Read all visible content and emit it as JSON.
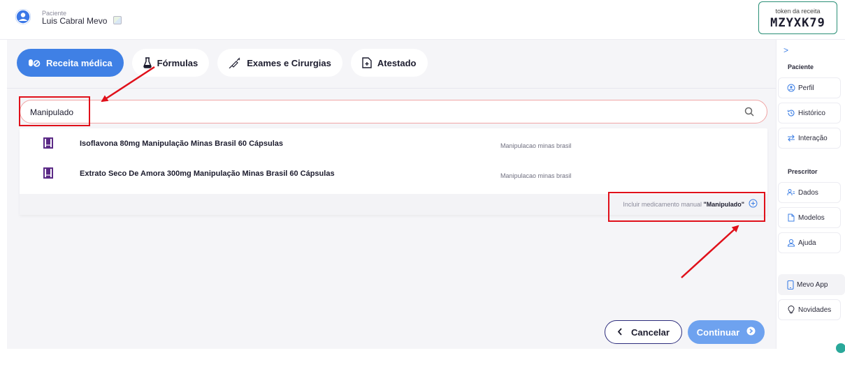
{
  "header": {
    "patient_caption": "Paciente",
    "patient_name": "Luis Cabral Mevo",
    "token_caption": "token da receita",
    "token_value": "MZYXK79"
  },
  "tabs": [
    {
      "label": "Receita médica",
      "icon": "pills-icon",
      "active": true
    },
    {
      "label": "Fórmulas",
      "icon": "flask-icon",
      "active": false
    },
    {
      "label": "Exames e Cirurgias",
      "icon": "syringe-icon",
      "active": false
    },
    {
      "label": "Atestado",
      "icon": "document-plus-icon",
      "active": false
    }
  ],
  "search": {
    "value": "Manipulado",
    "icon": "search-icon"
  },
  "results": [
    {
      "name": "Isoflavona 80mg Manipulação Minas Brasil 60 Cápsulas",
      "lab": "Manipulacao minas brasil",
      "icon": "medicine-box-icon"
    },
    {
      "name": "Extrato Seco De Amora 300mg Manipulação Minas Brasil 60 Cápsulas",
      "lab": "Manipulacao minas brasil",
      "icon": "medicine-box-icon"
    }
  ],
  "manual": {
    "prefix": "Incluir medicamento manual ",
    "term": "\"Manipulado\"",
    "icon": "plus-circle-icon"
  },
  "actions": {
    "cancel_label": "Cancelar",
    "continue_label": "Continuar"
  },
  "sidebar": {
    "toggle": ">",
    "section_patient": "Paciente",
    "section_prescriber": "Prescritor",
    "items_patient": [
      {
        "label": "Perfil",
        "icon": "user-circle-icon"
      },
      {
        "label": "Histórico",
        "icon": "history-icon"
      },
      {
        "label": "Interação",
        "icon": "swap-arrows-icon"
      }
    ],
    "items_prescriber": [
      {
        "label": "Dados",
        "icon": "user-data-icon"
      },
      {
        "label": "Modelos",
        "icon": "file-icon"
      },
      {
        "label": "Ajuda",
        "icon": "help-user-icon"
      }
    ],
    "items_bottom": [
      {
        "label": "Mevo App",
        "icon": "phone-icon"
      },
      {
        "label": "Novidades",
        "icon": "lightbulb-icon"
      }
    ]
  },
  "colors": {
    "primary": "#3f80e5",
    "primary_light": "#6ea2ef",
    "accent_purple": "#5b2a86",
    "token_border": "#2a8f76",
    "annotation_red": "#e0101a"
  }
}
